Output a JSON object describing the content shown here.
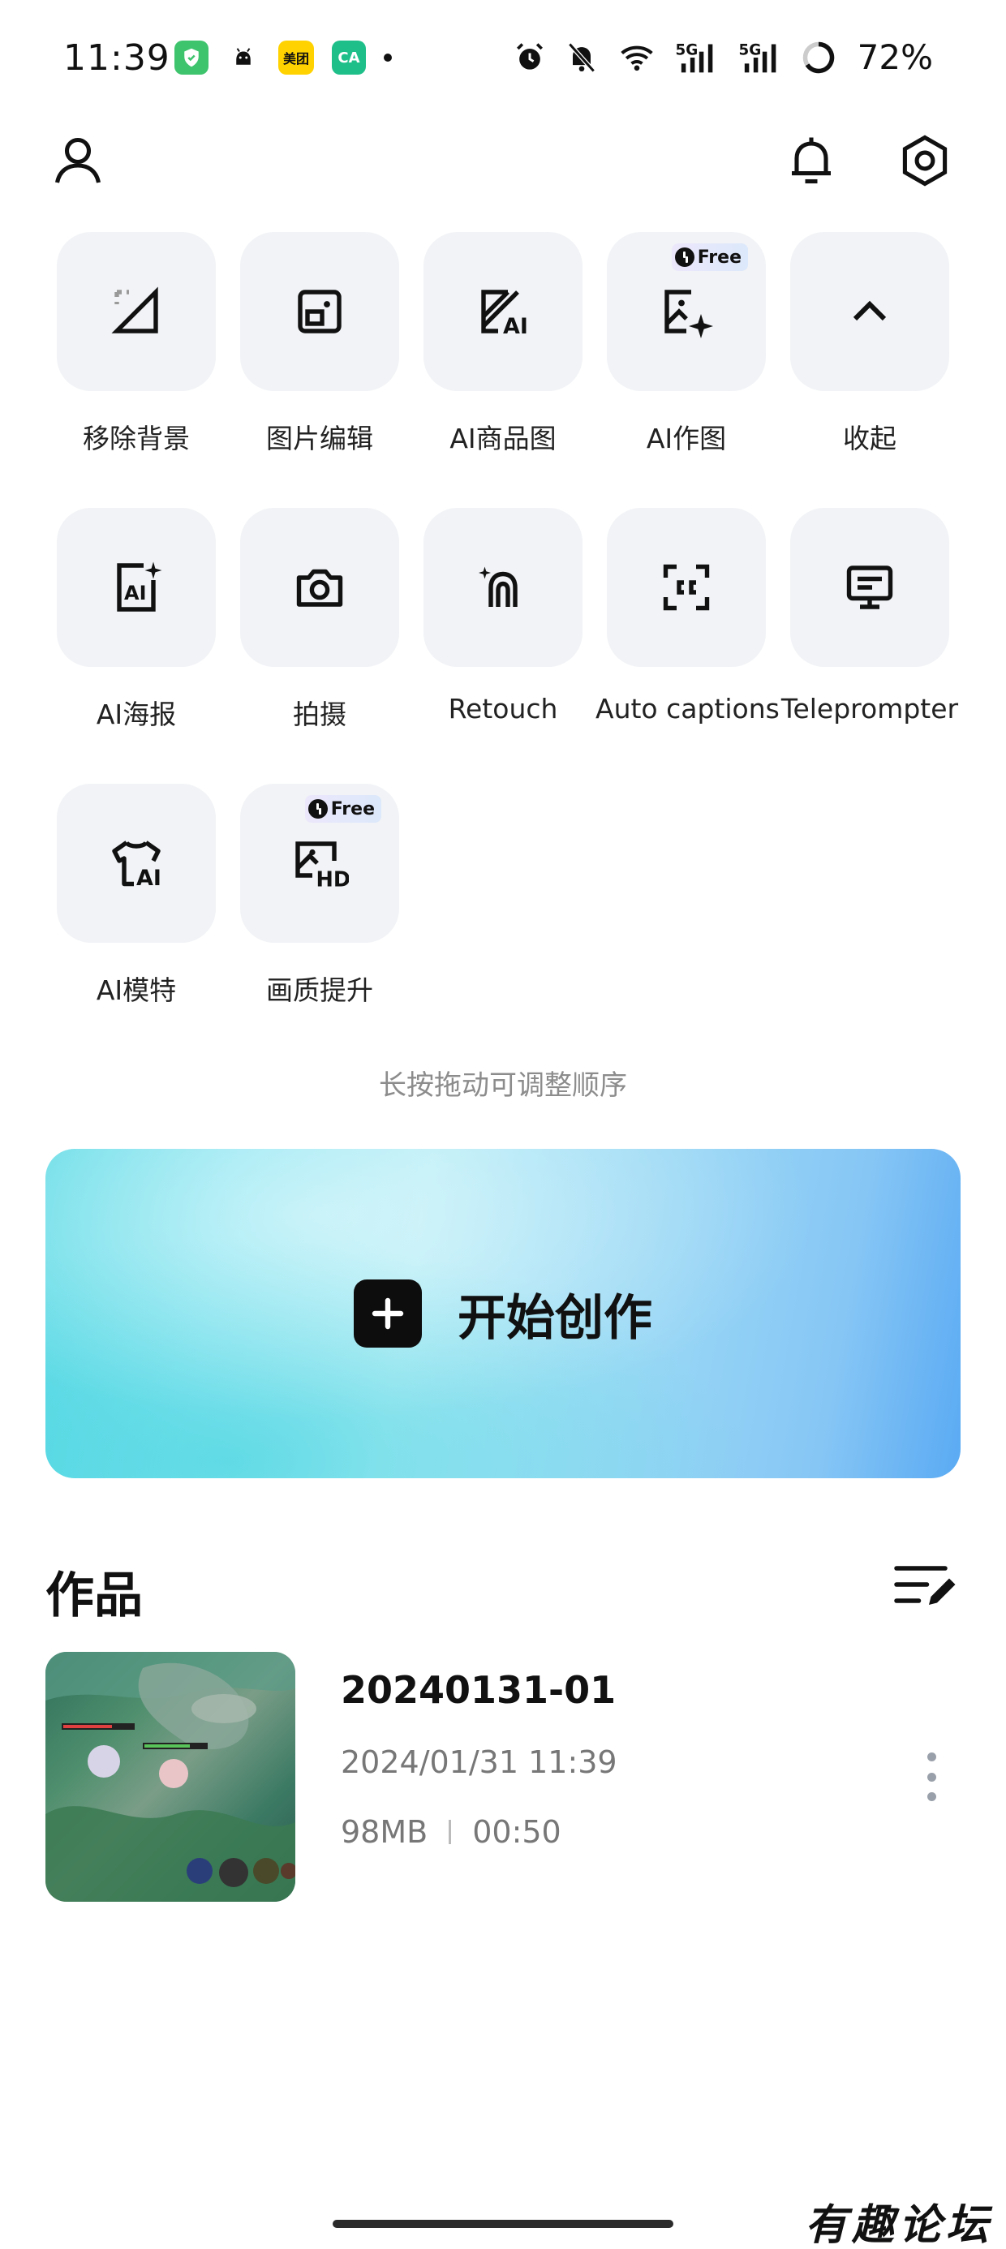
{
  "status_bar": {
    "time": "11:39",
    "notification_icons": [
      "shield-app-icon",
      "android-icon",
      "meituan-icon",
      "ca-app-icon"
    ],
    "meituan_label": "美团",
    "ca_label": "CA",
    "system_icons": [
      "alarm-icon",
      "mute-icon",
      "wifi-icon",
      "5g-signal-icon",
      "5g-signal-icon",
      "battery-icon"
    ],
    "network_label": "5G",
    "battery": "72%"
  },
  "header": {
    "left_icon": "profile-icon",
    "right_icons": [
      "bell-icon",
      "settings-icon"
    ]
  },
  "tools": [
    {
      "label": "移除背景",
      "icon": "remove-background-icon",
      "free": false
    },
    {
      "label": "图片编辑",
      "icon": "image-edit-icon",
      "free": false
    },
    {
      "label": "AI商品图",
      "icon": "ai-product-image-icon",
      "free": false
    },
    {
      "label": "AI作图",
      "icon": "ai-image-icon",
      "free": true
    },
    {
      "label": "收起",
      "icon": "chevron-up-icon",
      "free": false
    },
    {
      "label": "AI海报",
      "icon": "ai-poster-icon",
      "free": false
    },
    {
      "label": "拍摄",
      "icon": "camera-icon",
      "free": false
    },
    {
      "label": "Retouch",
      "icon": "retouch-icon",
      "free": false
    },
    {
      "label": "Auto captions",
      "icon": "captions-icon",
      "free": false
    },
    {
      "label": "Teleprompter",
      "icon": "teleprompter-icon",
      "free": false
    },
    {
      "label": "AI模特",
      "icon": "ai-model-icon",
      "free": false
    },
    {
      "label": "画质提升",
      "icon": "hd-enhance-icon",
      "free": true
    }
  ],
  "free_badge_label": "Free",
  "hint": "长按拖动可调整顺序",
  "create_button": {
    "label": "开始创作",
    "icon": "plus-icon"
  },
  "works": {
    "title": "作品",
    "edit_icon": "edit-list-icon",
    "items": [
      {
        "name": "20240131-01",
        "date": "2024/01/31 11:39",
        "size": "98MB",
        "duration": "00:50"
      }
    ]
  },
  "watermark": "有趣论坛",
  "colors": {
    "tool_bg": "#f1f3f6",
    "banner_start": "#5fdbe6",
    "banner_end": "#5aaaf3",
    "muted_text": "#777777"
  }
}
